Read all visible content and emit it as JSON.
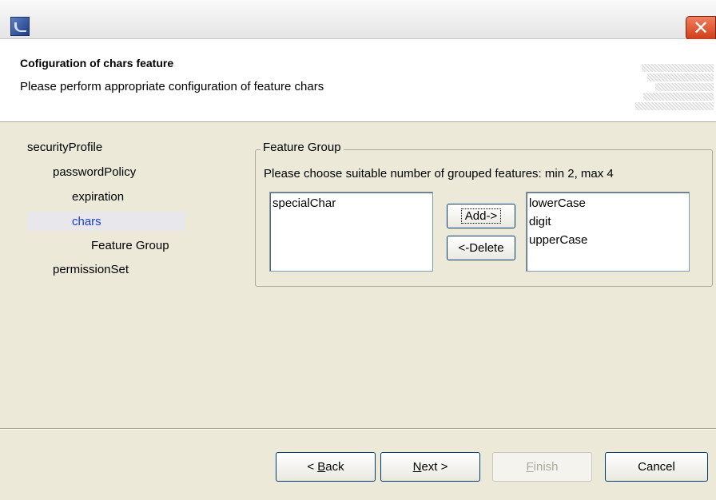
{
  "header": {
    "title": "Cofiguration of chars feature",
    "subtitle": "Please perform appropriate configuration of feature chars"
  },
  "tree": [
    {
      "label": "securityProfile"
    },
    {
      "label": "passwordPolicy"
    },
    {
      "label": "expiration"
    },
    {
      "label": "chars",
      "selected": true
    },
    {
      "label": "Feature Group"
    },
    {
      "label": "permissionSet"
    }
  ],
  "feature_group": {
    "legend": "Feature Group",
    "hint": "Please choose suitable number of grouped features: min 2, max 4",
    "available": [
      "specialChar"
    ],
    "selected": [
      "lowerCase",
      "digit",
      "upperCase"
    ],
    "add_label": "Add->",
    "delete_label": "<-Delete"
  },
  "buttons": {
    "back_prefix": "< ",
    "back_mnemonic": "B",
    "back_rest": "ack",
    "next_mnemonic": "N",
    "next_rest": "ext >",
    "finish_mnemonic": "F",
    "finish_rest": "inish",
    "cancel": "Cancel"
  },
  "colors": {
    "selected_tree_text": "#1c3bd8",
    "close_button": "#d13d17"
  },
  "icons": {
    "app": "eclipse-icon",
    "close": "close-icon"
  }
}
